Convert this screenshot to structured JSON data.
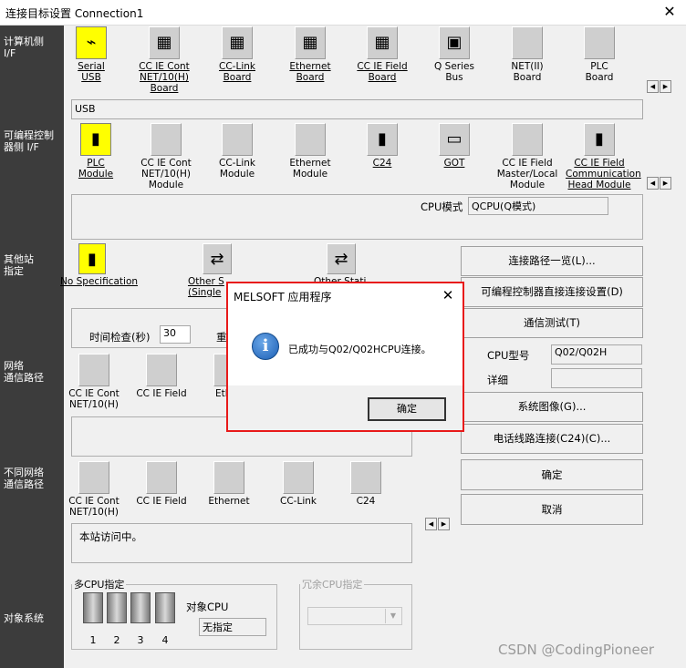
{
  "window": {
    "title": "连接目标设置 Connection1",
    "close_glyph": "✕"
  },
  "sidebar": {
    "pc_if": "计算机侧\nI/F",
    "plc_if": "可编程控制\n器侧 I/F",
    "other_station": "其他站\n指定",
    "network_route": "网络\n通信路径",
    "diff_network": "不同网络\n通信路径",
    "target_system": "对象系统"
  },
  "pc_side": {
    "items": [
      {
        "label": "Serial\nUSB",
        "icon": "serial-usb-icon"
      },
      {
        "label": "CC IE Cont\nNET/10(H)\nBoard",
        "icon": "board-icon"
      },
      {
        "label": "CC-Link\nBoard",
        "icon": "board-icon"
      },
      {
        "label": "Ethernet\nBoard",
        "icon": "board-icon"
      },
      {
        "label": "CC IE Field\nBoard",
        "icon": "board-icon"
      },
      {
        "label": "Q Series\nBus",
        "icon": "pc-icon"
      },
      {
        "label": "NET(II)\nBoard",
        "icon": "blank-icon"
      },
      {
        "label": "PLC\nBoard",
        "icon": "blank-icon"
      }
    ],
    "detail": "USB"
  },
  "plc_side": {
    "items": [
      {
        "label": "PLC\nModule",
        "icon": "plc-module-icon"
      },
      {
        "label": "CC IE Cont\nNET/10(H)\nModule",
        "icon": "blank-icon"
      },
      {
        "label": "CC-Link\nModule",
        "icon": "blank-icon"
      },
      {
        "label": "Ethernet\nModule",
        "icon": "blank-icon"
      },
      {
        "label": "C24",
        "icon": "c24-icon"
      },
      {
        "label": "GOT",
        "icon": "got-icon"
      },
      {
        "label": "CC IE Field\nMaster/Local\nModule",
        "icon": "blank-icon"
      },
      {
        "label": "CC IE Field\nCommunication\nHead Module",
        "icon": "head-module-icon"
      }
    ],
    "cpu_mode_label": "CPU模式",
    "cpu_mode_value": "QCPU(Q模式)"
  },
  "other_station": {
    "items": [
      {
        "label": "No Specification"
      },
      {
        "label": "Other S\n(Single"
      },
      {
        "label": "Other Stati"
      }
    ],
    "time_check_label": "时间检查(秒)",
    "time_check_value": "30",
    "retry_label": "重"
  },
  "network_route": {
    "items": [
      {
        "label": "CC IE Cont\nNET/10(H)"
      },
      {
        "label": "CC IE Field"
      },
      {
        "label": "Eth"
      }
    ]
  },
  "diff_network": {
    "items": [
      {
        "label": "CC IE Cont\nNET/10(H)"
      },
      {
        "label": "CC IE Field"
      },
      {
        "label": "Ethernet"
      },
      {
        "label": "CC-Link"
      },
      {
        "label": "C24"
      }
    ],
    "detail": "本站访问中。"
  },
  "right_panel": {
    "route_list": "连接路径一览(L)...",
    "direct_connect": "可编程控制器直接连接设置(D)",
    "comm_test": "通信测试(T)",
    "cpu_type_label": "CPU型号",
    "cpu_type_value": "Q02/Q02H",
    "detail_label": "详细",
    "detail_value": "",
    "system_image": "系统图像(G)...",
    "phone_connect": "电话线路连接(C24)(C)...",
    "ok": "确定",
    "cancel": "取消"
  },
  "multi_cpu": {
    "legend": "多CPU指定",
    "target_cpu_label": "对象CPU",
    "target_cpu_value": "无指定",
    "units": [
      "1",
      "2",
      "3",
      "4"
    ]
  },
  "redundant_cpu": {
    "legend": "冗余CPU指定"
  },
  "dialog": {
    "title": "MELSOFT 应用程序",
    "icon_glyph": "i",
    "message": "已成功与Q02/Q02HCPU连接。",
    "ok": "确定"
  },
  "watermark": "CSDN @CodingPioneer",
  "colors": {
    "sidebar": "#3c3c3c",
    "selected": "#ffff00",
    "dialog_border": "#e81a1a"
  }
}
